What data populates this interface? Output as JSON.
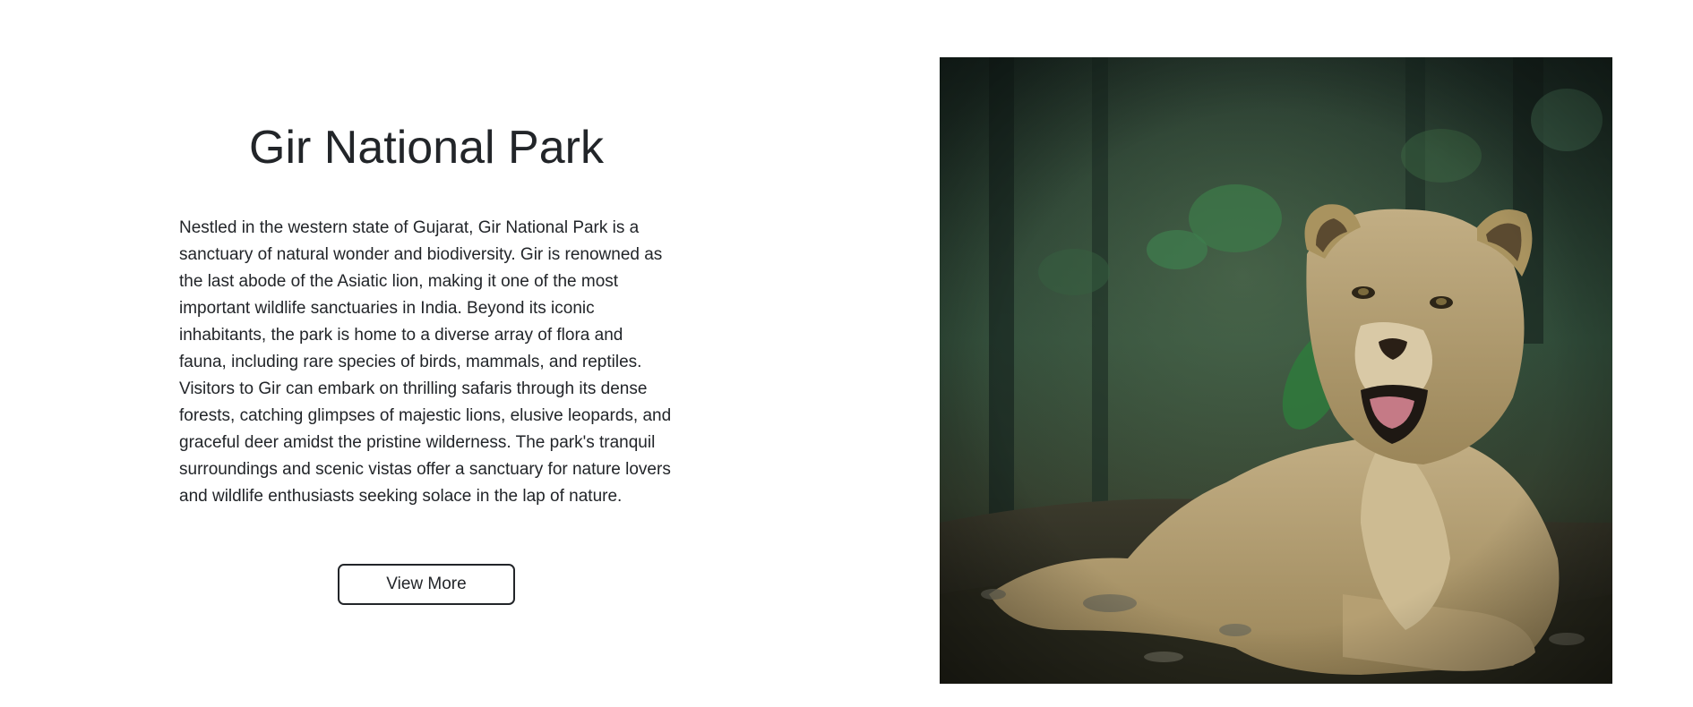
{
  "park": {
    "title": "Gir National Park",
    "description": "Nestled in the western state of Gujarat, Gir National Park is a sanctuary of natural wonder and biodiversity. Gir is renowned as the last abode of the Asiatic lion, making it one of the most important wildlife sanctuaries in India. Beyond its iconic inhabitants, the park is home to a diverse array of flora and fauna, including rare species of birds, mammals, and reptiles. Visitors to Gir can embark on thrilling safaris through its dense forests, catching glimpses of majestic lions, elusive leopards, and graceful deer amidst the pristine wilderness. The park's tranquil surroundings and scenic vistas offer a sanctuary for nature lovers and wildlife enthusiasts seeking solace in the lap of nature.",
    "button_label": "View More",
    "photo_subject": "asiatic-lioness-resting-in-forest"
  },
  "colors": {
    "text": "#222529",
    "background": "#ffffff",
    "button_border": "#222529"
  }
}
